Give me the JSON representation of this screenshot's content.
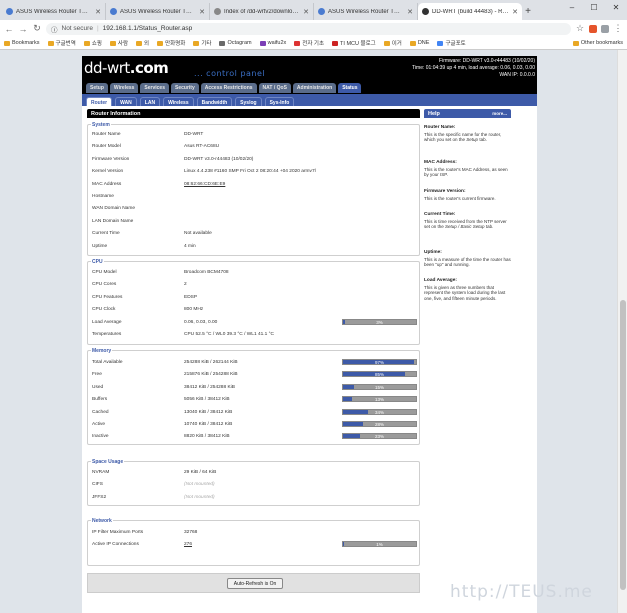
{
  "browser": {
    "tabs": [
      {
        "title": "ASUS Wireless Router TM-AC1",
        "active": false
      },
      {
        "title": "ASUS Wireless Router TM-AC1",
        "active": false
      },
      {
        "title": "Index of /dd-wrtv2/downloads",
        "active": false
      },
      {
        "title": "ASUS Wireless Router TM-AC1",
        "active": false
      },
      {
        "title": "DD-WRT (build 44483) - Router",
        "active": true
      }
    ],
    "new_tab": "+",
    "window_controls": [
      "–",
      "☐",
      "✕"
    ],
    "security": "Not secure",
    "separator": "|",
    "url": "192.168.1.1/Status_Router.asp",
    "bookmarks": [
      "Bookmarks",
      "구글번역",
      "쇼핑",
      "사람",
      "외",
      "만화명화",
      "기타",
      "Octagram",
      "waifu2x",
      "전자 기초",
      "TI MCU 블로그",
      "이거",
      "DNE",
      "구글포토"
    ],
    "other_bookmarks": "Other bookmarks"
  },
  "header": {
    "logo_light": "dd-wrt",
    "logo_bold": ".com",
    "control_panel": "... control panel",
    "firmware_line": "Firmware: DD-WRT v3.0-r44483 (10/02/20)",
    "time_line": "Time: 01:04:39 up 4 min, load average: 0.06, 0.03, 0.00",
    "wan_line": "WAN IP: 0.0.0.0"
  },
  "main_tabs": [
    {
      "label": "Setup",
      "active": false
    },
    {
      "label": "Wireless",
      "active": false
    },
    {
      "label": "Services",
      "active": false
    },
    {
      "label": "Security",
      "active": false
    },
    {
      "label": "Access Restrictions",
      "active": false
    },
    {
      "label": "NAT / QoS",
      "active": false
    },
    {
      "label": "Administration",
      "active": false
    },
    {
      "label": "Status",
      "active": true
    }
  ],
  "sub_tabs": [
    {
      "label": "Router",
      "active": true
    },
    {
      "label": "WAN",
      "active": false
    },
    {
      "label": "LAN",
      "active": false
    },
    {
      "label": "Wireless",
      "active": false
    },
    {
      "label": "Bandwidth",
      "active": false
    },
    {
      "label": "Syslog",
      "active": false
    },
    {
      "label": "Sys-Info",
      "active": false
    }
  ],
  "section_title": "Router Information",
  "system": {
    "legend": "System",
    "rows": [
      {
        "label": "Router Name",
        "value": "DD-WRT"
      },
      {
        "label": "Router Model",
        "value": "Asus RT-AC68U"
      },
      {
        "label": "Firmware Version",
        "value": "DD-WRT v3.0-r44483 (10/02/20)"
      },
      {
        "label": "Kernel Version",
        "value": "Linux 4.4.238 #1160 SMP Fri Oct 2 08:20:44 +04 2020 armv7l"
      },
      {
        "label": "MAC Address",
        "value": "08:62:66:CD:6E:E9"
      },
      {
        "label": "Hostname",
        "value": ""
      },
      {
        "label": "WAN Domain Name",
        "value": ""
      },
      {
        "label": "LAN Domain Name",
        "value": ""
      },
      {
        "label": "Current Time",
        "value": "Not available"
      },
      {
        "label": "Uptime",
        "value": "4 min"
      }
    ]
  },
  "cpu": {
    "legend": "CPU",
    "rows": [
      {
        "label": "CPU Model",
        "value": "Broadcom BCM4708"
      },
      {
        "label": "CPU Cores",
        "value": "2"
      },
      {
        "label": "CPU Features",
        "value": "EDSP"
      },
      {
        "label": "CPU Clock",
        "value": "800 MHz"
      },
      {
        "label": "Load Average",
        "value": "0.06, 0.03, 0.00",
        "percent": 3,
        "meter_text": "3%"
      },
      {
        "label": "Temperatures",
        "value": "CPU 52.5 °C / WL0 39.3 °C / WL1 41.1 °C"
      }
    ]
  },
  "memory": {
    "legend": "Memory",
    "rows": [
      {
        "label": "Total Available",
        "value": "254288 KiB / 262144 KiB",
        "percent": 97,
        "meter_text": "97%"
      },
      {
        "label": "Free",
        "value": "215876 KiB / 254288 KiB",
        "percent": 85,
        "meter_text": "85%"
      },
      {
        "label": "Used",
        "value": "38412 KiB / 254288 KiB",
        "percent": 15,
        "meter_text": "15%"
      },
      {
        "label": "Buffers",
        "value": "5056 KiB / 38412 KiB",
        "percent": 13,
        "meter_text": "13%"
      },
      {
        "label": "Cached",
        "value": "13040 KiB / 38412 KiB",
        "percent": 34,
        "meter_text": "34%"
      },
      {
        "label": "Active",
        "value": "10740 KiB / 38412 KiB",
        "percent": 28,
        "meter_text": "28%"
      },
      {
        "label": "Inactive",
        "value": "8820 KiB / 38412 KiB",
        "percent": 23,
        "meter_text": "23%"
      }
    ]
  },
  "space": {
    "legend": "Space Usage",
    "rows": [
      {
        "label": "NVRAM",
        "value": "29 KiB / 64 KiB"
      },
      {
        "label": "CIFS",
        "value": "(Not mounted)"
      },
      {
        "label": "JFFS2",
        "value": "(Not mounted)"
      }
    ]
  },
  "network": {
    "legend": "Network",
    "rows": [
      {
        "label": "IP Filter Maximum Ports",
        "value": "32768"
      },
      {
        "label": "Active IP Connections",
        "value": "276",
        "percent": 1,
        "meter_text": "1%"
      }
    ]
  },
  "auto_refresh_label": "Auto-Refresh is On",
  "help": {
    "title": "Help",
    "more": "more...",
    "sections": [
      {
        "title": "Router Name:",
        "text": "This is the specific name for the router, which you set on the",
        "em": "Setup",
        "tail": "tab."
      },
      {
        "title": "MAC Address:",
        "text": "This is the router's MAC Address, as seen by your ISP.",
        "em": "",
        "tail": ""
      },
      {
        "title": "Firmware Version:",
        "text": "This is the router's current firmware.",
        "em": "",
        "tail": ""
      },
      {
        "title": "Current Time:",
        "text": "This is time received from the NTP server set on the",
        "em": "Setup / Basic Setup",
        "tail": "tab."
      },
      {
        "title": "Uptime:",
        "text": "This is a measure of the time the router has been \"up\" and running.",
        "em": "",
        "tail": ""
      },
      {
        "title": "Load Average:",
        "text": "This is given as three numbers that represent the system load during the last one, five, and fifteen minute periods.",
        "em": "",
        "tail": ""
      }
    ]
  },
  "watermark": "http://TEUS.me",
  "colors": {
    "accent": "#3d5aa8",
    "header_bg": "#000000",
    "page_bg": "#dfe4ea",
    "meter_empty": "#9b9b9b"
  }
}
